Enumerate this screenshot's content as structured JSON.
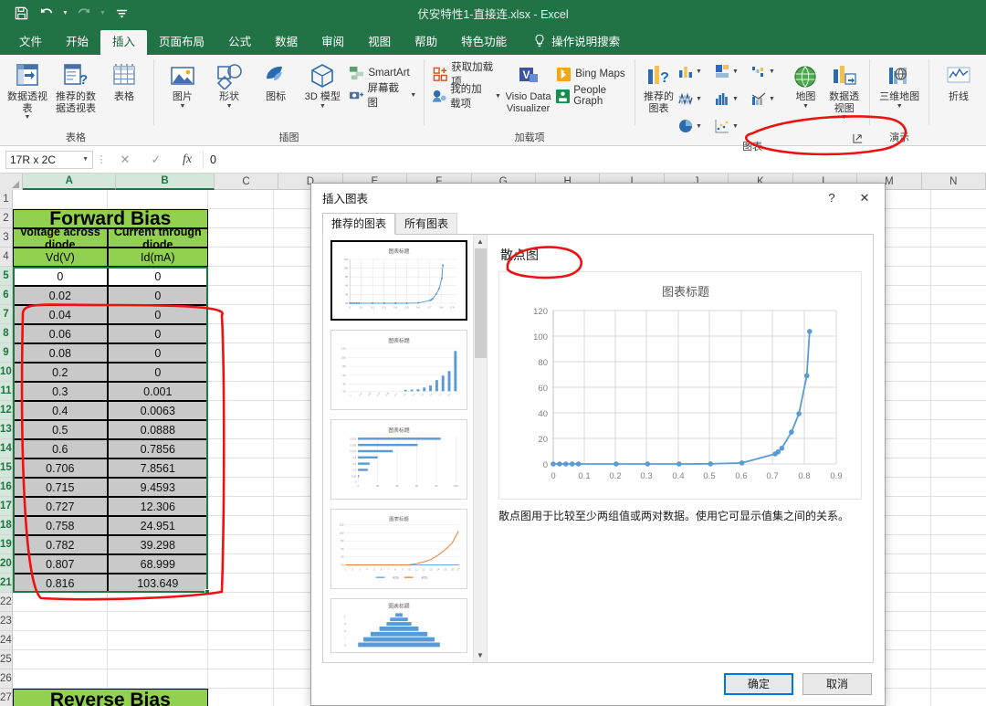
{
  "titlebar": {
    "document_title": "伏安特性1-直接连.xlsx  -  Excel",
    "qat": [
      {
        "name": "save",
        "glyph": "💾"
      },
      {
        "name": "undo",
        "glyph": "↶"
      },
      {
        "name": "redo",
        "glyph": "↷"
      },
      {
        "name": "customize",
        "glyph": "☰"
      }
    ]
  },
  "tabs": [
    {
      "label": "文件",
      "active": false
    },
    {
      "label": "开始",
      "active": false
    },
    {
      "label": "插入",
      "active": true
    },
    {
      "label": "页面布局",
      "active": false
    },
    {
      "label": "公式",
      "active": false
    },
    {
      "label": "数据",
      "active": false
    },
    {
      "label": "审阅",
      "active": false
    },
    {
      "label": "视图",
      "active": false
    },
    {
      "label": "帮助",
      "active": false
    },
    {
      "label": "特色功能",
      "active": false
    }
  ],
  "tellme": {
    "label": "操作说明搜索"
  },
  "ribbon": {
    "groups": [
      {
        "label": "表格",
        "buttons": [
          {
            "label": "数据透视表",
            "caret": true
          },
          {
            "label": "推荐的数据透视表",
            "caret": false
          },
          {
            "label": "表格",
            "caret": false
          }
        ]
      },
      {
        "label": "插图",
        "buttons": [
          {
            "label": "图片",
            "caret": true
          },
          {
            "label": "形状",
            "caret": true
          },
          {
            "label": "图标",
            "caret": false
          },
          {
            "label": "3D 模型",
            "caret": true
          }
        ],
        "small": [
          {
            "label": "SmartArt"
          },
          {
            "label": "屏幕截图",
            "caret": true
          }
        ]
      },
      {
        "label": "加载项",
        "small": [
          {
            "label": "获取加载项"
          },
          {
            "label": "我的加载项",
            "caret": true
          }
        ],
        "buttons": [
          {
            "label": "Visio Data Visualizer"
          },
          {
            "label": "Bing Maps"
          },
          {
            "label": "People Graph"
          }
        ]
      },
      {
        "label": "图表",
        "buttons": [
          {
            "label": "推荐的图表",
            "caret": false
          },
          {
            "label": "地图",
            "caret": true
          },
          {
            "label": "数据透视图",
            "caret": true
          }
        ],
        "has_launcher": true
      },
      {
        "label": "演示",
        "buttons": [
          {
            "label": "三维地图",
            "caret": true
          }
        ]
      },
      {
        "label": "",
        "buttons": [
          {
            "label": "折线",
            "caret": false
          }
        ]
      }
    ]
  },
  "formulabar": {
    "namebox_value": "17R x 2C",
    "cancel_icon": "✕",
    "confirm_icon": "✓",
    "fx_label": "fx",
    "value": "0"
  },
  "grid": {
    "columns": [
      "A",
      "B",
      "C",
      "D",
      "E",
      "F",
      "G",
      "H",
      "I",
      "J",
      "K",
      "L",
      "M",
      "N"
    ],
    "selected_columns": [
      "A",
      "B"
    ],
    "rows": [
      1,
      2,
      3,
      4,
      5,
      6,
      7,
      8,
      9,
      10,
      11,
      12,
      13,
      14,
      15,
      16,
      17,
      18,
      19,
      20,
      21,
      22,
      23,
      24,
      25,
      26,
      27
    ],
    "selected_rows": [
      5,
      6,
      7,
      8,
      9,
      10,
      11,
      12,
      13,
      14,
      15,
      16,
      17,
      18,
      19,
      20,
      21
    ],
    "forward_bias_title": "Forward Bias",
    "reverse_bias_title": "Reverse Bias",
    "header_a": "Voltage across diode",
    "header_b": "Current through diode",
    "unit_a": "Vd(V)",
    "unit_b": "Id(mA)",
    "data": [
      {
        "row": 5,
        "a": "0",
        "b": "0"
      },
      {
        "row": 6,
        "a": "0.02",
        "b": "0"
      },
      {
        "row": 7,
        "a": "0.04",
        "b": "0"
      },
      {
        "row": 8,
        "a": "0.06",
        "b": "0"
      },
      {
        "row": 9,
        "a": "0.08",
        "b": "0"
      },
      {
        "row": 10,
        "a": "0.2",
        "b": "0"
      },
      {
        "row": 11,
        "a": "0.3",
        "b": "0.001"
      },
      {
        "row": 12,
        "a": "0.4",
        "b": "0.0063"
      },
      {
        "row": 13,
        "a": "0.5",
        "b": "0.0888"
      },
      {
        "row": 14,
        "a": "0.6",
        "b": "0.7856"
      },
      {
        "row": 15,
        "a": "0.706",
        "b": "7.8561"
      },
      {
        "row": 16,
        "a": "0.715",
        "b": "9.4593"
      },
      {
        "row": 17,
        "a": "0.727",
        "b": "12.306"
      },
      {
        "row": 18,
        "a": "0.758",
        "b": "24.951"
      },
      {
        "row": 19,
        "a": "0.782",
        "b": "39.298"
      },
      {
        "row": 20,
        "a": "0.807",
        "b": "68.999"
      },
      {
        "row": 21,
        "a": "0.816",
        "b": "103.649"
      }
    ]
  },
  "dialog": {
    "title": "插入图表",
    "help_icon": "?",
    "close_icon": "✕",
    "tabs": [
      {
        "label": "推荐的图表",
        "active": true
      },
      {
        "label": "所有图表",
        "active": false
      }
    ],
    "preview_heading": "散点图",
    "description": "散点图用于比较至少两组值或两对数据。使用它可显示值集之间的关系。",
    "ok_label": "确定",
    "cancel_label": "取消",
    "thumbnails": [
      {
        "name": "scatter",
        "title": "图表标题",
        "selected": true
      },
      {
        "name": "column",
        "title": "图表标题",
        "selected": false
      },
      {
        "name": "bar",
        "title": "图表标题",
        "selected": false
      },
      {
        "name": "line",
        "title": "图表标题",
        "selected": false
      },
      {
        "name": "funnel",
        "title": "图表标题",
        "selected": false
      }
    ]
  },
  "chart_data": {
    "type": "scatter",
    "title": "图表标题",
    "xlabel": "",
    "ylabel": "",
    "xlim": [
      0,
      0.9
    ],
    "ylim": [
      0,
      120
    ],
    "xticks": [
      "0",
      "0.1",
      "0.2",
      "0.3",
      "0.4",
      "0.5",
      "0.6",
      "0.7",
      "0.8",
      "0.9"
    ],
    "yticks": [
      "0",
      "20",
      "40",
      "60",
      "80",
      "100",
      "120"
    ],
    "grid": true,
    "legend": "none",
    "series_color": "#4E87C7",
    "series": [
      {
        "name": "Id(mA)",
        "x": [
          0,
          0.02,
          0.04,
          0.06,
          0.08,
          0.2,
          0.3,
          0.4,
          0.5,
          0.6,
          0.706,
          0.715,
          0.727,
          0.758,
          0.782,
          0.807,
          0.816
        ],
        "y": [
          0,
          0,
          0,
          0,
          0,
          0,
          0.001,
          0.0063,
          0.0888,
          0.7856,
          7.8561,
          9.4593,
          12.306,
          24.951,
          39.298,
          68.999,
          103.649
        ]
      }
    ]
  },
  "annotations": {
    "color": "#ee1111",
    "marks": [
      {
        "name": "ribbon-chart-launcher-circle"
      },
      {
        "name": "data-range-circle"
      },
      {
        "name": "scatter-heading-circle"
      }
    ]
  }
}
